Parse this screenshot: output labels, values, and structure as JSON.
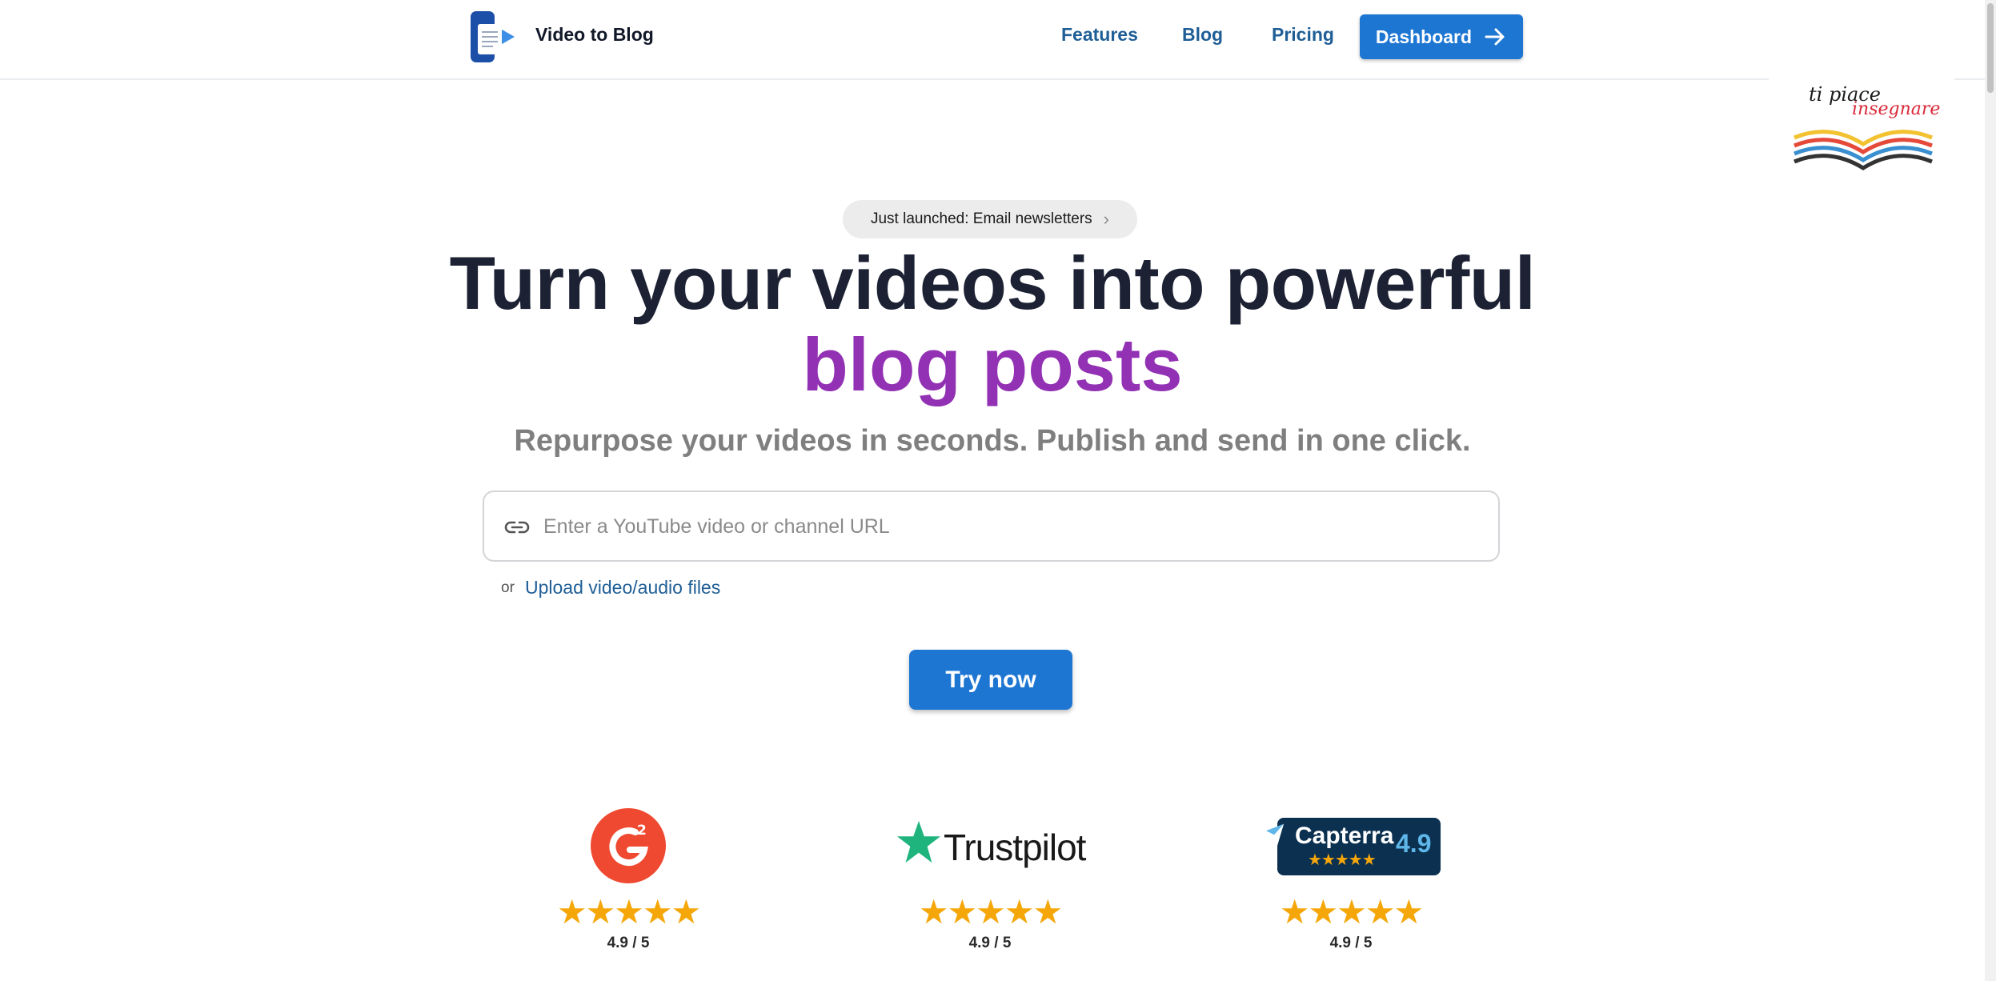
{
  "header": {
    "brand": "Video to Blog",
    "nav": {
      "features": "Features",
      "blog": "Blog",
      "pricing": "Pricing"
    },
    "dashboard_label": "Dashboard"
  },
  "overlay_logo": {
    "line1": "ti piace",
    "line2": "insegnare"
  },
  "hero": {
    "badge": "Just launched: Email newsletters",
    "headline_line1": "Turn your videos into powerful",
    "headline_line2": "blog posts",
    "subheadline": "Repurpose your videos in seconds. Publish and send in one click.",
    "url_placeholder": "Enter a YouTube video or channel URL",
    "or_text": "or",
    "upload_label": "Upload video/audio files",
    "try_label": "Try now"
  },
  "ratings": [
    {
      "source": "G2",
      "stars": "★★★★★",
      "score": "4.9 / 5"
    },
    {
      "source": "Trustpilot",
      "stars": "★★★★★",
      "score": "4.9 / 5"
    },
    {
      "source": "Capterra",
      "badge_score": "4.9",
      "stars": "★★★★★",
      "score": "4.9 / 5"
    }
  ],
  "colors": {
    "primary_button": "#1e76d3",
    "accent_purple": "#9231b3",
    "nav_link": "#1f5e96",
    "star": "#f5a70a"
  },
  "icons": [
    "document-play-logo-icon",
    "arrow-right-icon",
    "chevron-right-icon",
    "link-icon",
    "g2-logo-icon",
    "trustpilot-star-icon",
    "capterra-flag-icon",
    "star-icon"
  ]
}
